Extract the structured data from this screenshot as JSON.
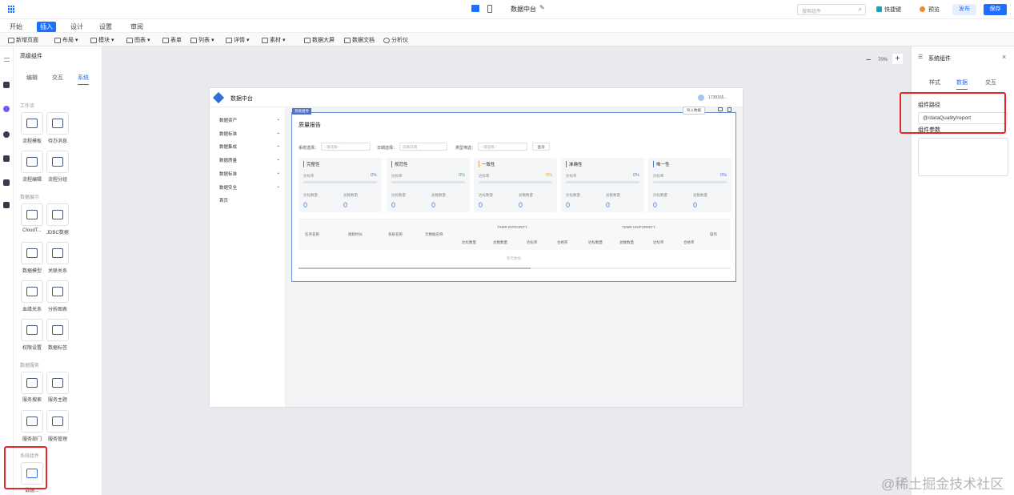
{
  "app": {
    "title": "数据中台",
    "edit_icon": "edit-icon"
  },
  "topbar": {
    "search_placeholder": "搜索组件",
    "shortcut": "快捷键",
    "preview": "预览",
    "publish": "发布",
    "save": "保存"
  },
  "menu": [
    "开始",
    "插入",
    "设计",
    "设置",
    "审阅"
  ],
  "menu_active": "插入",
  "toolbar": [
    "新增页面",
    "布局 ▾",
    "模块 ▾",
    "图表 ▾",
    "表单",
    "列表 ▾",
    "详情 ▾",
    "素材 ▾",
    "数据大屏",
    "数据文档",
    "分析仪"
  ],
  "left_panel": {
    "title": "高级组件",
    "tabs": [
      "编辑",
      "交互",
      "系统"
    ],
    "active_tab": "系统",
    "sections": [
      {
        "title": "工作流",
        "items": [
          "流程模板",
          "待办消息",
          "流程编辑",
          "流程分组"
        ]
      },
      {
        "title": "数据展示",
        "items": [
          "CloudT...",
          "JDBC数据",
          "数据模型",
          "关联关系",
          "血缘关系",
          "分析图表",
          "权限设置",
          "数据标签"
        ]
      },
      {
        "title": "数据服务",
        "items": [
          "服务搜索",
          "服务主题",
          "服务部门",
          "服务管理"
        ]
      },
      {
        "title": "系统组件",
        "items": [
          "数据..."
        ]
      }
    ]
  },
  "canvas": {
    "zoom": "70%"
  },
  "right_panel": {
    "title": "系统组件",
    "tabs": [
      "样式",
      "数据",
      "交互"
    ],
    "active_tab": "数据",
    "path_label": "组件路径",
    "path_value": "@/dataQuality/report",
    "params_label": "组件参数"
  },
  "preview": {
    "app_name": "数据中台",
    "user": "1738166...",
    "nav": [
      "数据资产",
      "数据标准",
      "数据集成",
      "数据质量",
      "数据标准",
      "数据安全",
      "首页"
    ],
    "badge": "系统组件",
    "toolbar_label": "导入数据",
    "report_title": "质量报告",
    "filters": [
      {
        "label": "系统选择：",
        "placeholder": "--请选择--"
      },
      {
        "label": "日期选择：",
        "placeholder": "选择日期"
      },
      {
        "label": "类型筛选：",
        "placeholder": "--请选择--"
      }
    ],
    "query_button": "查询",
    "metrics": [
      {
        "name": "完整性",
        "rate_label": "达标率",
        "pct": "0%",
        "pass_label": "达标数量",
        "total_label": "总数数量",
        "pass": "0",
        "total": "0"
      },
      {
        "name": "规范性",
        "rate_label": "达标率",
        "pct": "0%",
        "pass_label": "达标数量",
        "total_label": "总数数量",
        "pass": "0",
        "total": "0"
      },
      {
        "name": "一致性",
        "rate_label": "达标率",
        "pct": "0%",
        "pass_label": "达标数量",
        "total_label": "总数数量",
        "pass": "0",
        "total": "0"
      },
      {
        "name": "准确性",
        "rate_label": "达标率",
        "pct": "0%",
        "pass_label": "达标数量",
        "total_label": "总数数量",
        "pass": "0",
        "total": "0"
      },
      {
        "name": "唯一性",
        "rate_label": "达标率",
        "pct": "0%",
        "pass_label": "达标数量",
        "total_label": "总数数量",
        "pass": "0",
        "total": "0"
      }
    ],
    "table": {
      "group1": "TSMR INTEGRITY",
      "group2": "TSMR UNIFORMITY",
      "cols": [
        "任务名称",
        "规则时长",
        "系统名称",
        "元数据名称",
        "达标数量",
        "总数数量",
        "达标率",
        "合格率",
        "达标数量",
        "总数数量",
        "达标率",
        "合格率",
        "操作"
      ],
      "empty": "暂无数据"
    }
  },
  "watermark": "@稀土掘金技术社区",
  "colors": {
    "accent": "#1e6fff",
    "highlight": "#e8262a",
    "metric": "#4a7bd9"
  }
}
